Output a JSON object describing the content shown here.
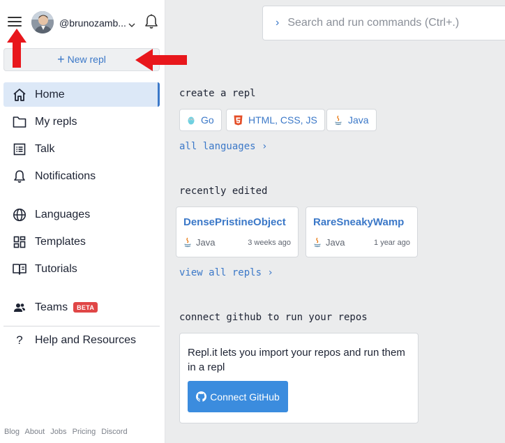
{
  "user": {
    "name": "@brunozamb..."
  },
  "sidebar": {
    "new_repl_label": "New repl",
    "items": [
      {
        "label": "Home",
        "icon": "home-icon",
        "active": true
      },
      {
        "label": "My repls",
        "icon": "folder-icon"
      },
      {
        "label": "Talk",
        "icon": "talk-icon"
      },
      {
        "label": "Notifications",
        "icon": "bell-icon"
      },
      {
        "label": "Languages",
        "icon": "globe-icon"
      },
      {
        "label": "Templates",
        "icon": "templates-icon"
      },
      {
        "label": "Tutorials",
        "icon": "book-icon"
      },
      {
        "label": "Teams",
        "icon": "team-icon",
        "badge": "BETA"
      },
      {
        "label": "Help and Resources",
        "icon": "question-icon"
      }
    ],
    "footer": [
      "Blog",
      "About",
      "Jobs",
      "Pricing",
      "Discord"
    ]
  },
  "search": {
    "placeholder": "Search and run commands (Ctrl+.)"
  },
  "create": {
    "title": "create a repl",
    "languages": [
      {
        "label": "Go",
        "icon": "go-icon"
      },
      {
        "label": "HTML, CSS, JS",
        "icon": "html5-icon"
      },
      {
        "label": "Java",
        "icon": "java-icon"
      }
    ],
    "all_languages": "all languages ›"
  },
  "recent": {
    "title": "recently edited",
    "repls": [
      {
        "name": "DensePristineObject",
        "lang": "Java",
        "time": "3 weeks ago"
      },
      {
        "name": "RareSneakyWamp",
        "lang": "Java",
        "time": "1 year ago"
      }
    ],
    "view_all": "view all repls ›"
  },
  "github": {
    "title": "connect github to run your repos",
    "text": "Repl.it lets you import your repos and run them in a repl",
    "button": "Connect GitHub"
  },
  "colors": {
    "accent": "#3b78c8",
    "annotation": "#e8171c",
    "button": "#3b8cde",
    "beta": "#e04646"
  }
}
